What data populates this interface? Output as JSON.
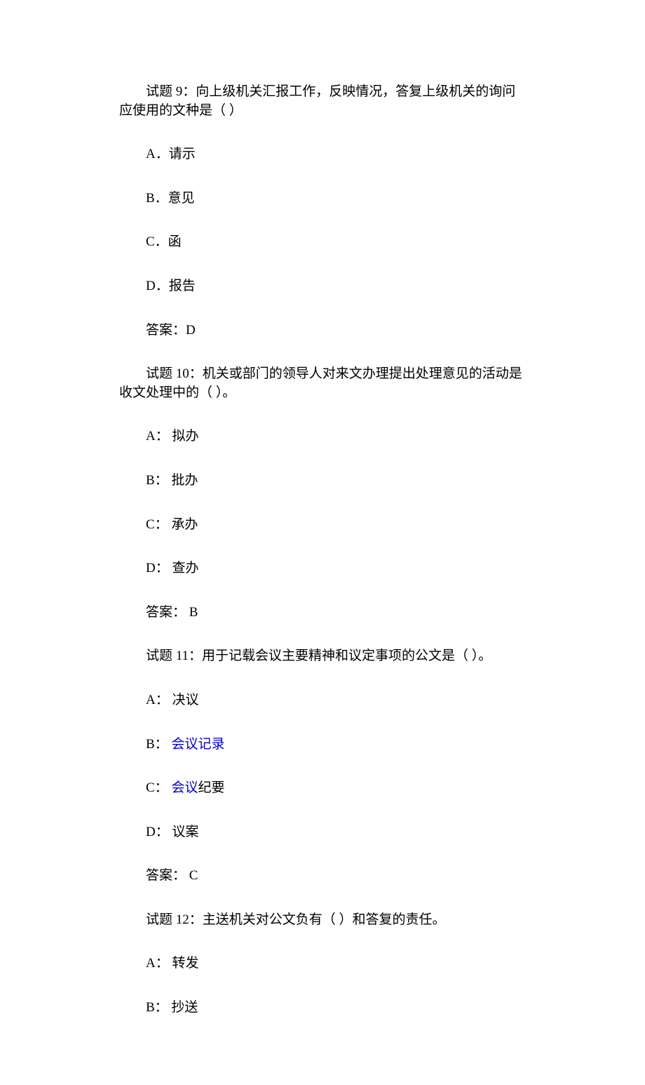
{
  "q9": {
    "text": "试题 9：向上级机关汇报工作，反映情况，答复上级机关的询问应使用的文种是（  ）",
    "opts": {
      "a": "A．请示",
      "b": "B．意见",
      "c": "C．函",
      "d": "D．报告"
    },
    "answer": "答案：D"
  },
  "q10": {
    "text": "试题 10：机关或部门的领导人对来文办理提出处理意见的活动是收文处理中的（  ）。",
    "opts": {
      "a": "A：  拟办",
      "b": "B：  批办",
      "c": "C：  承办",
      "d": "D：  查办"
    },
    "answer": "答案：  B"
  },
  "q11": {
    "text": "试题 11：用于记载会议主要精神和议定事项的公文是（  ）。",
    "opts": {
      "a": "A：  决议",
      "b_prefix": "B：  ",
      "b_link": "会议记录",
      "c_prefix": "C：  ",
      "c_link": "会议",
      "c_suffix": "纪要",
      "d": "D：  议案"
    },
    "answer": "答案：  C"
  },
  "q12": {
    "text": "试题 12：主送机关对公文负有（  ）和答复的责任。",
    "opts": {
      "a": "A：  转发",
      "b": "B：  抄送"
    }
  }
}
